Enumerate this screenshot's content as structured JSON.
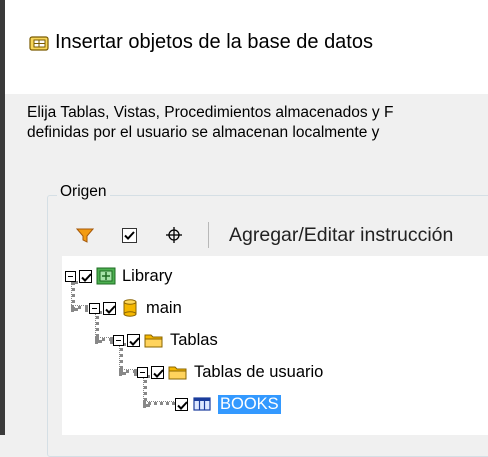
{
  "window": {
    "title": "Insertar objetos de la base de datos",
    "title_icon": "database-objects-icon"
  },
  "description": {
    "line1": "Elija Tablas, Vistas, Procedimientos almacenados y F",
    "line2": "definidas por el usuario se almacenan localmente y"
  },
  "source_group": {
    "label": "Origen"
  },
  "toolbar": {
    "filter_icon": "filter-icon",
    "check_icon": "check-all-icon",
    "locate_icon": "locate-icon",
    "add_edit_label": "Agregar/Editar instrucción"
  },
  "tree": {
    "nodes": [
      {
        "label": "Library",
        "icon": "library-icon",
        "checked": true
      },
      {
        "label": "main",
        "icon": "database-icon",
        "checked": true
      },
      {
        "label": "Tablas",
        "icon": "folder-icon",
        "checked": true
      },
      {
        "label": "Tablas de usuario",
        "icon": "folder-icon",
        "checked": true
      },
      {
        "label": "BOOKS",
        "icon": "table-icon",
        "checked": true,
        "selected": true
      }
    ]
  },
  "colors": {
    "selection": "#3399ff",
    "folder": "#f5b700",
    "library": "#4caf50"
  }
}
